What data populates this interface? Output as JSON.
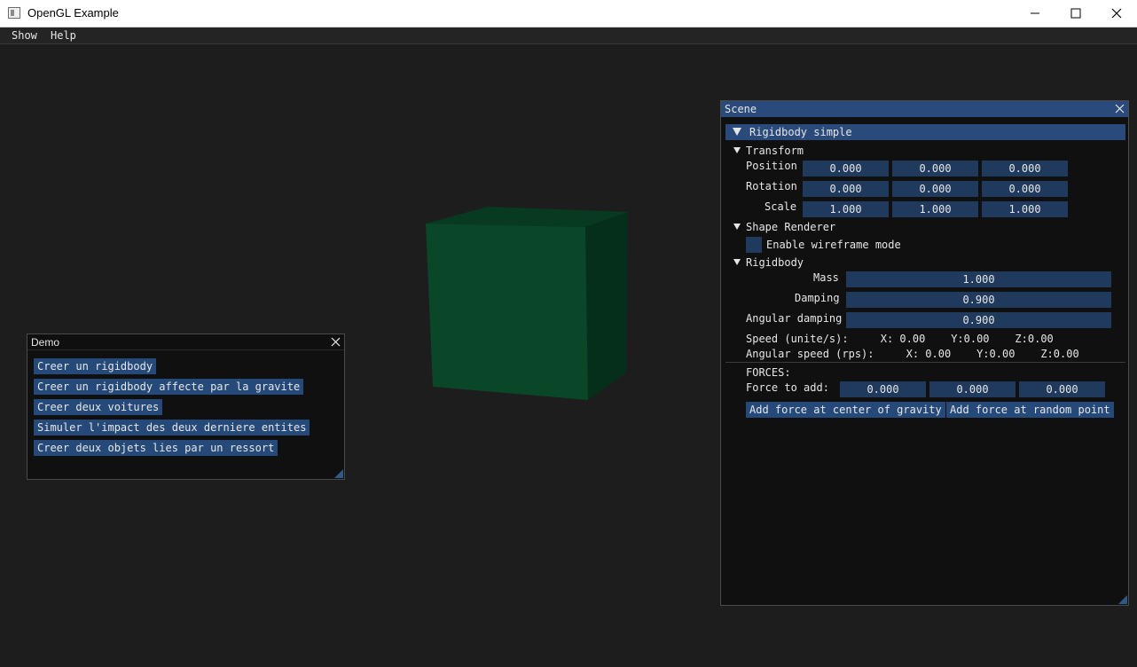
{
  "window": {
    "title": "OpenGL Example"
  },
  "menu": {
    "items": [
      "Show",
      "Help"
    ]
  },
  "demo": {
    "title": "Demo",
    "buttons": [
      "Creer un rigidbody",
      "Creer un rigidbody affecte par la gravite",
      "Creer deux voitures",
      "Simuler l'impact des deux derniere entites",
      "Creer deux objets lies par un ressort"
    ]
  },
  "scene": {
    "title": "Scene",
    "object_header": "Rigidbody simple",
    "transform": {
      "header": "Transform",
      "position_label": "Position",
      "position": [
        "0.000",
        "0.000",
        "0.000"
      ],
      "rotation_label": "Rotation",
      "rotation": [
        "0.000",
        "0.000",
        "0.000"
      ],
      "scale_label": "Scale",
      "scale": [
        "1.000",
        "1.000",
        "1.000"
      ]
    },
    "shape_renderer": {
      "header": "Shape Renderer",
      "wireframe_label": "Enable wireframe mode",
      "wireframe_enabled": false
    },
    "rigidbody": {
      "header": "Rigidbody",
      "mass_label": "Mass",
      "mass": "1.000",
      "damping_label": "Damping",
      "damping": "0.900",
      "angular_damping_label": "Angular damping",
      "angular_damping": "0.900",
      "speed_text": "Speed (unite/s):     X: 0.00    Y:0.00    Z:0.00",
      "angular_speed_text": "Angular speed (rps):     X: 0.00    Y:0.00    Z:0.00"
    },
    "forces": {
      "header": "FORCES:",
      "force_label": "Force to add:",
      "force": [
        "0.000",
        "0.000",
        "0.000"
      ],
      "center_button": "Add force at center of gravity",
      "random_button": "Add force at random point"
    }
  },
  "colors": {
    "background": "#1d1d1d",
    "button": "#254a7a",
    "title_active": "#294a7a",
    "cube_front": "#0a4628",
    "cube_top": "#073a21",
    "cube_side": "#062f1b"
  }
}
